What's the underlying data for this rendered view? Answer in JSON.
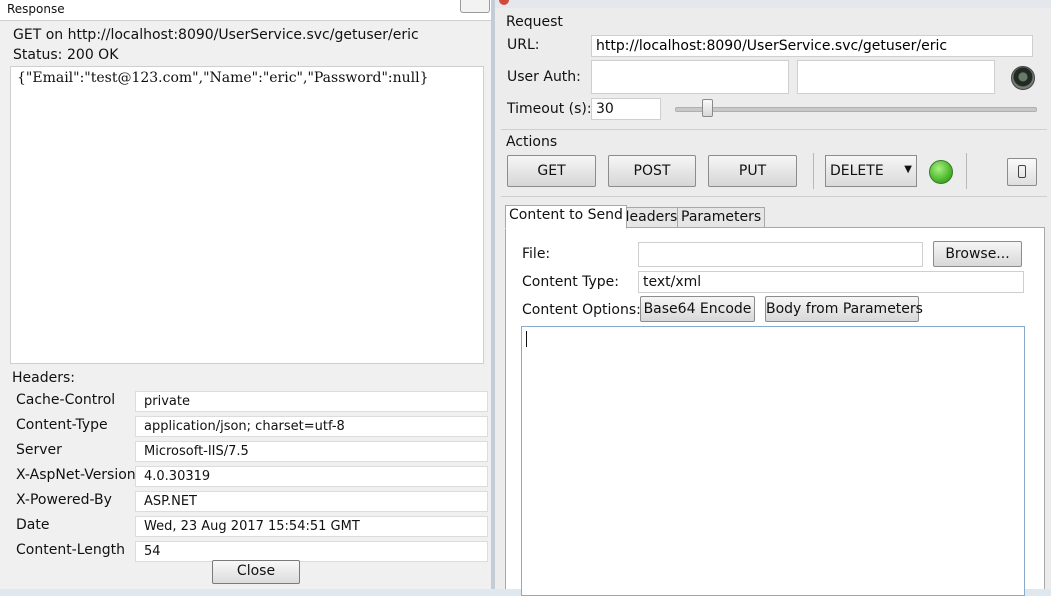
{
  "response": {
    "title": "Response",
    "request_line": "GET on http://localhost:8090/UserService.svc/getuser/eric",
    "status_label": "Status:",
    "status_value": "200 OK",
    "body": "{\"Email\":\"test@123.com\",\"Name\":\"eric\",\"Password\":null}",
    "headers_label": "Headers:",
    "headers": [
      {
        "name": "Cache-Control",
        "value": "private"
      },
      {
        "name": "Content-Type",
        "value": "application/json; charset=utf-8"
      },
      {
        "name": "Server",
        "value": "Microsoft-IIS/7.5"
      },
      {
        "name": "X-AspNet-Version",
        "value": "4.0.30319"
      },
      {
        "name": "X-Powered-By",
        "value": "ASP.NET"
      },
      {
        "name": "Date",
        "value": "Wed, 23 Aug 2017 15:54:51 GMT"
      },
      {
        "name": "Content-Length",
        "value": "54"
      }
    ],
    "close_label": "Close"
  },
  "request": {
    "section_label": "Request",
    "url_label": "URL:",
    "url_value": "http://localhost:8090/UserService.svc/getuser/eric",
    "auth_label": "User Auth:",
    "auth_user": "",
    "auth_password": "",
    "timeout_label": "Timeout (s):",
    "timeout_value": "30"
  },
  "actions": {
    "section_label": "Actions",
    "get_label": "GET",
    "post_label": "POST",
    "put_label": "PUT",
    "method_selected": "DELETE",
    "status_light_color": "#4cb82c"
  },
  "tabs": [
    {
      "label": "Content to Send",
      "active": true
    },
    {
      "label": "Headers",
      "active": false
    },
    {
      "label": "Parameters",
      "active": false
    }
  ],
  "content": {
    "file_label": "File:",
    "file_value": "",
    "browse_label": "Browse...",
    "content_type_label": "Content Type:",
    "content_type_value": "text/xml",
    "options_label": "Content Options:",
    "base64_label": "Base64 Encode",
    "body_from_params_label": "Body from Parameters",
    "body_value": ""
  },
  "icons": {
    "auth": "auth-dial-icon",
    "lock": "lock-icon",
    "status": "status-light-icon"
  }
}
